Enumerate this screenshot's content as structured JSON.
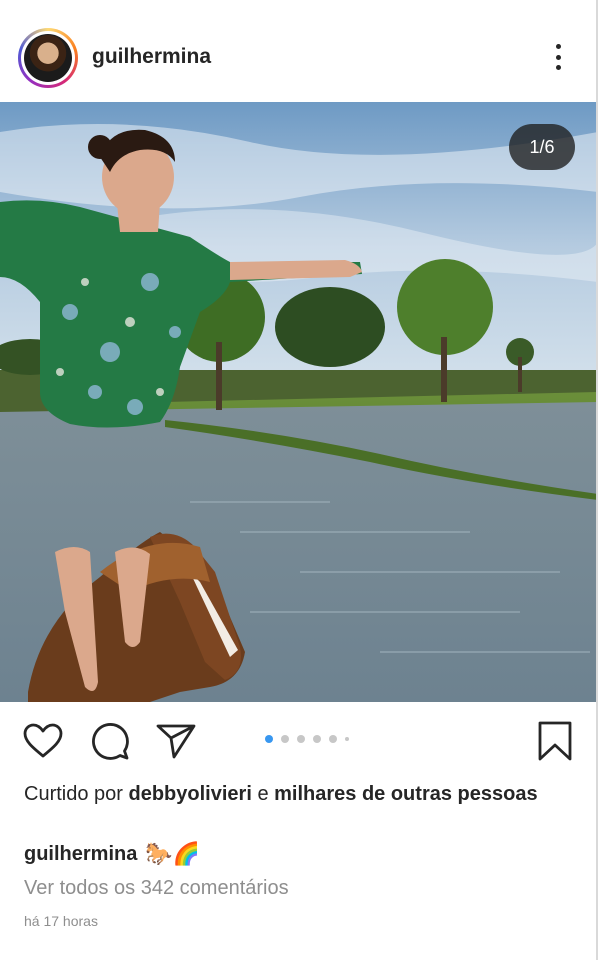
{
  "post": {
    "username": "guilhermina",
    "image_counter": "1/6",
    "carousel": {
      "total_dots": 6,
      "active_index": 0
    },
    "likes": {
      "prefix": "Curtido por",
      "user": "debbyolivieri",
      "connector": "e",
      "others": "milhares de outras pessoas"
    },
    "caption": {
      "username": "guilhermina",
      "emoji": "🐎🌈"
    },
    "comments_link": "Ver todos os 342 comentários",
    "timestamp": "há 17 horas"
  },
  "icons": {
    "like": "heart-icon",
    "comment": "comment-icon",
    "share": "send-icon",
    "save": "bookmark-icon",
    "more": "more-icon"
  },
  "colors": {
    "text": "#262626",
    "secondary": "#8e8e8e",
    "active_dot": "#3897f0",
    "inactive_dot": "#c7c7c7",
    "counter_bg": "#1e1e1e"
  }
}
